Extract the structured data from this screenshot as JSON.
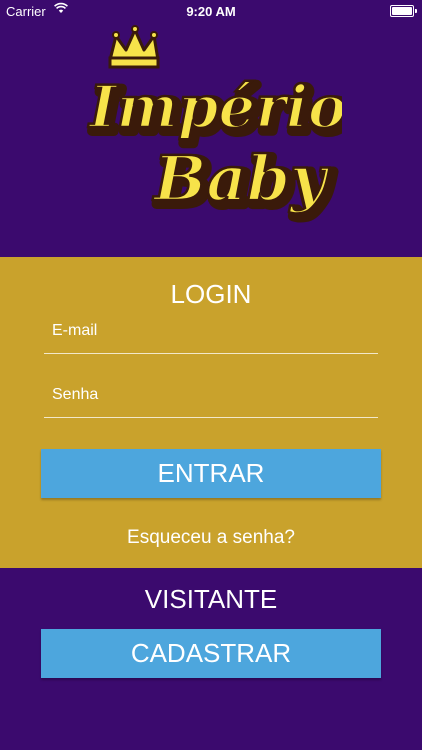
{
  "status_bar": {
    "carrier": "Carrier",
    "time": "9:20 AM"
  },
  "logo": {
    "line1": "Império",
    "line2": "Baby"
  },
  "login": {
    "title": "LOGIN",
    "email_placeholder": "E-mail",
    "password_placeholder": "Senha",
    "enter_label": "ENTRAR",
    "forgot_label": "Esqueceu a senha?"
  },
  "visitor": {
    "title": "VISITANTE",
    "register_label": "CADASTRAR"
  },
  "colors": {
    "purple": "#3b0a6e",
    "gold": "#c9a22c",
    "button_blue": "#4da6dd",
    "logo_yellow": "#f7e34a"
  }
}
